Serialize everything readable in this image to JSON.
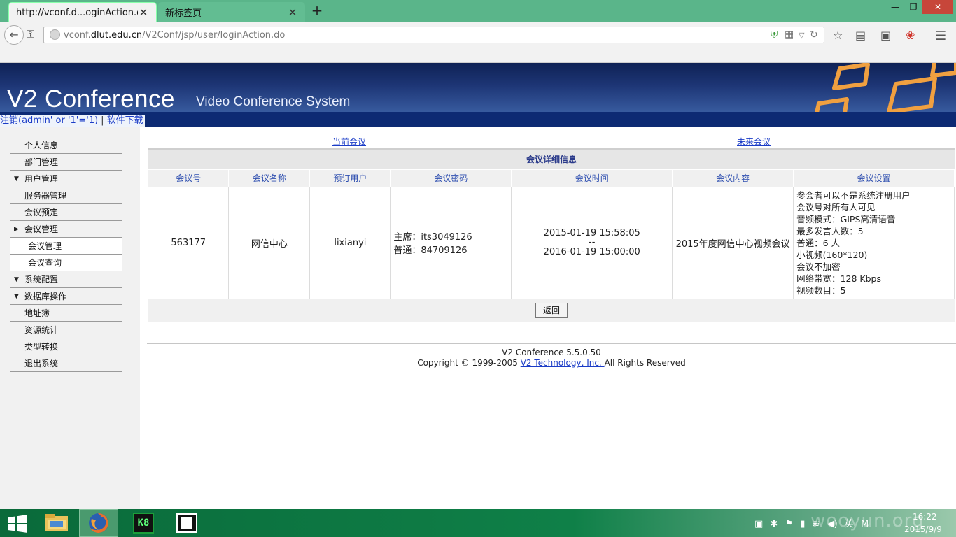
{
  "browser": {
    "tabs": [
      {
        "title": "http://vconf.d...oginAction.do"
      },
      {
        "title": "新标签页"
      }
    ],
    "new_tab_symbol": "+",
    "url": {
      "domain_pre": "vconf.",
      "domain_main": "dlut.edu.cn",
      "path": "/V2Conf/jsp/user/loginAction.do"
    },
    "icons": [
      "back-icon",
      "key-icon",
      "globe-icon",
      "shield-icon",
      "qr-icon",
      "reload-icon",
      "star-icon",
      "reader-icon",
      "pocket-icon",
      "addon-icon",
      "menu-icon"
    ]
  },
  "banner": {
    "title": "V2 Conference",
    "subtitle": "Video Conference System"
  },
  "userbar": {
    "logout": "注销(admin' or '1'='1)",
    "separator": "|",
    "download": "软件下载"
  },
  "sidebar": {
    "items": [
      {
        "label": "个人信息"
      },
      {
        "label": "部门管理"
      },
      {
        "label": "用户管理"
      },
      {
        "label": "服务器管理"
      },
      {
        "label": "会议预定"
      },
      {
        "label": "会议管理"
      },
      {
        "label": "会议管理"
      },
      {
        "label": "会议查询"
      },
      {
        "label": "系统配置"
      },
      {
        "label": "数据库操作"
      },
      {
        "label": "地址簿"
      },
      {
        "label": "资源统计"
      },
      {
        "label": "类型转换"
      },
      {
        "label": "退出系统"
      }
    ]
  },
  "content": {
    "current_meeting_link": "当前会议",
    "future_meeting_link": "未来会议",
    "detail_title": "会议详细信息",
    "columns": [
      "会议号",
      "会议名称",
      "预订用户",
      "会议密码",
      "会议时间",
      "会议内容",
      "会议设置"
    ],
    "row": {
      "id": "563177",
      "name": "网信中心",
      "user": "lixianyi",
      "password_chair": "主席：its3049126",
      "password_normal": "普通：84709126",
      "time_start": "2015-01-19 15:58:05",
      "time_sep": "--",
      "time_end": "2016-01-19 15:00:00",
      "content": "2015年度网信中心视频会议",
      "settings": [
        "参会者可以不是系统注册用户",
        "会议号对所有人可见",
        "音频模式：GIPS高清语音",
        "最多发言人数：5",
        "普通：6 人",
        "小视频(160*120)",
        "会议不加密",
        "网络带宽：128 Kbps",
        "视频数目：5"
      ]
    },
    "return_button": "返回",
    "footer_version": "V2 Conference 5.5.0.50",
    "footer_copy_pre": "Copyright © 1999-2005 ",
    "footer_copy_link": "V2 Technology, Inc. ",
    "footer_copy_post": "All Rights Reserved"
  },
  "taskbar": {
    "k8_label": "K8",
    "tray_lang": "英",
    "tray_m": "M",
    "time": "16:22",
    "date": "2015/9/9",
    "watermark": "wooyun.org"
  },
  "colors": {
    "chrome_green": "#5ab58a",
    "banner_navy": "#1d3575",
    "userbar_navy": "#0d2a73",
    "link_blue": "#1b3cc7",
    "header_text_blue": "#3050b0",
    "taskbar_green": "#0f8048",
    "close_red": "#c7463a",
    "banner_orange": "#f0a040"
  }
}
